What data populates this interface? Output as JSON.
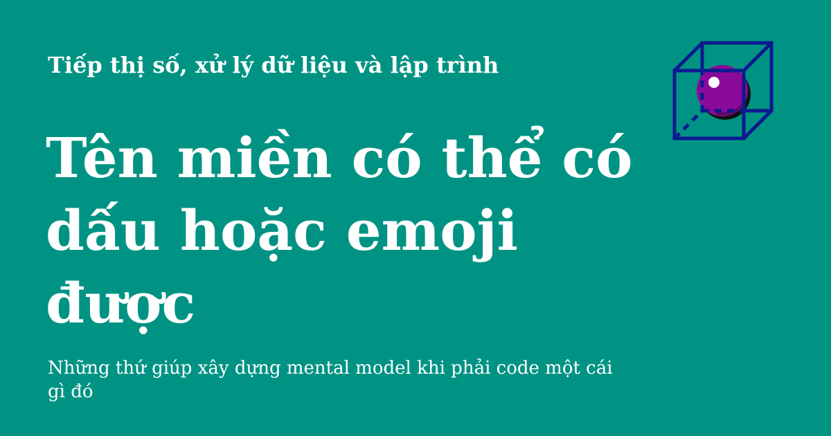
{
  "header": {
    "kicker": "Tiếp thị số, xử lý dữ liệu và lập trình"
  },
  "main": {
    "title": "Tên miền có thể có dấu hoặc emoji được",
    "subtitle": "Những thứ giúp xây dựng mental model khi phải code một cái gì đó"
  },
  "logo": {
    "icon": "cube-with-sphere-icon",
    "colors": {
      "cube": "#0c1a8f",
      "sphere": "#8a0a9a",
      "sphere_shadow": "#111111",
      "highlight": "#ffffff"
    }
  },
  "colors": {
    "background": "#009383",
    "text": "#ffffff"
  }
}
